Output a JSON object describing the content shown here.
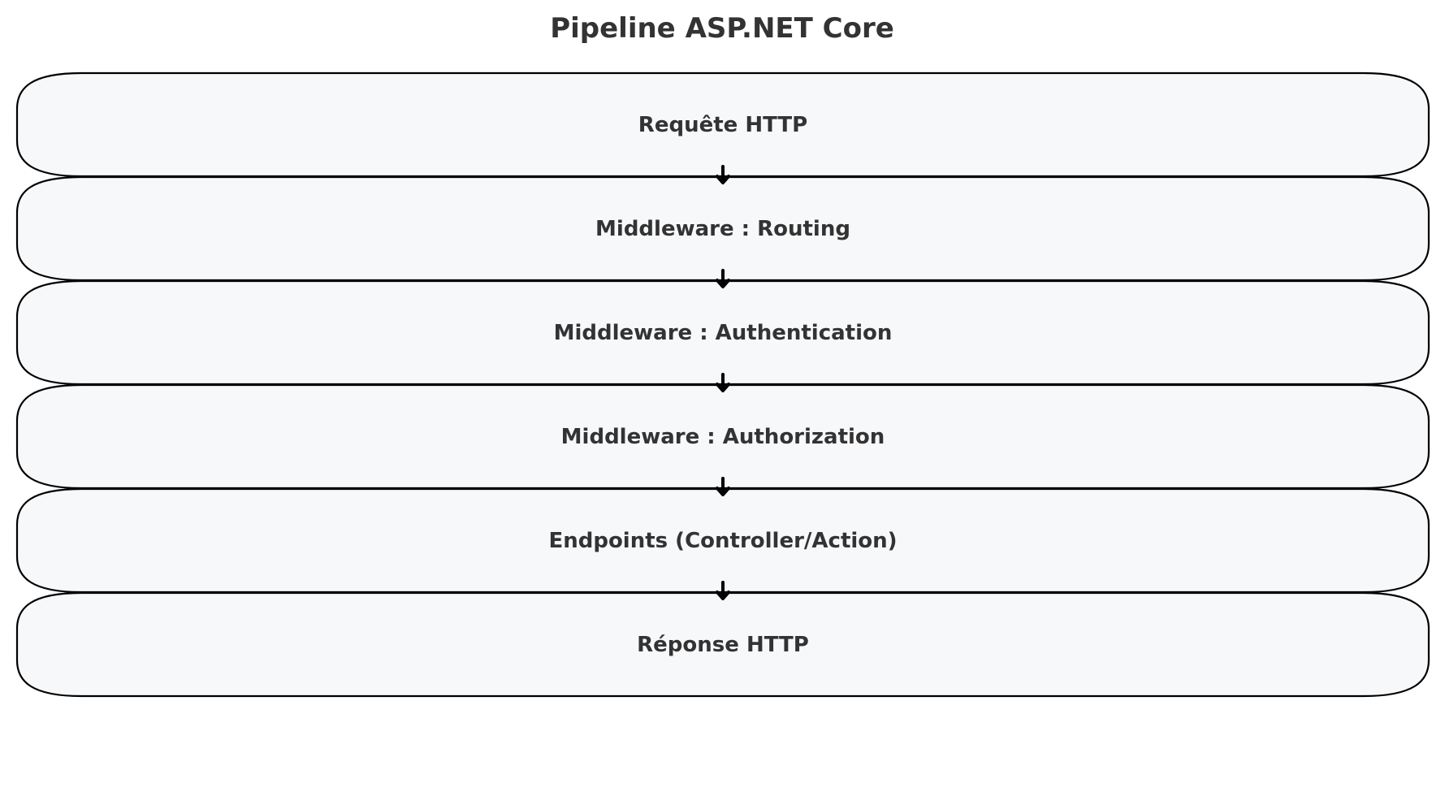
{
  "diagram": {
    "title": "Pipeline ASP.NET Core",
    "steps": [
      {
        "label": "Requête HTTP"
      },
      {
        "label": "Middleware : Routing"
      },
      {
        "label": "Middleware : Authentication"
      },
      {
        "label": "Middleware : Authorization"
      },
      {
        "label": "Endpoints (Controller/Action)"
      },
      {
        "label": "Réponse HTTP"
      }
    ],
    "colors": {
      "box_fill": "#f7f8fa",
      "box_stroke": "#000000",
      "text": "#333333",
      "arrow": "#000000"
    }
  }
}
